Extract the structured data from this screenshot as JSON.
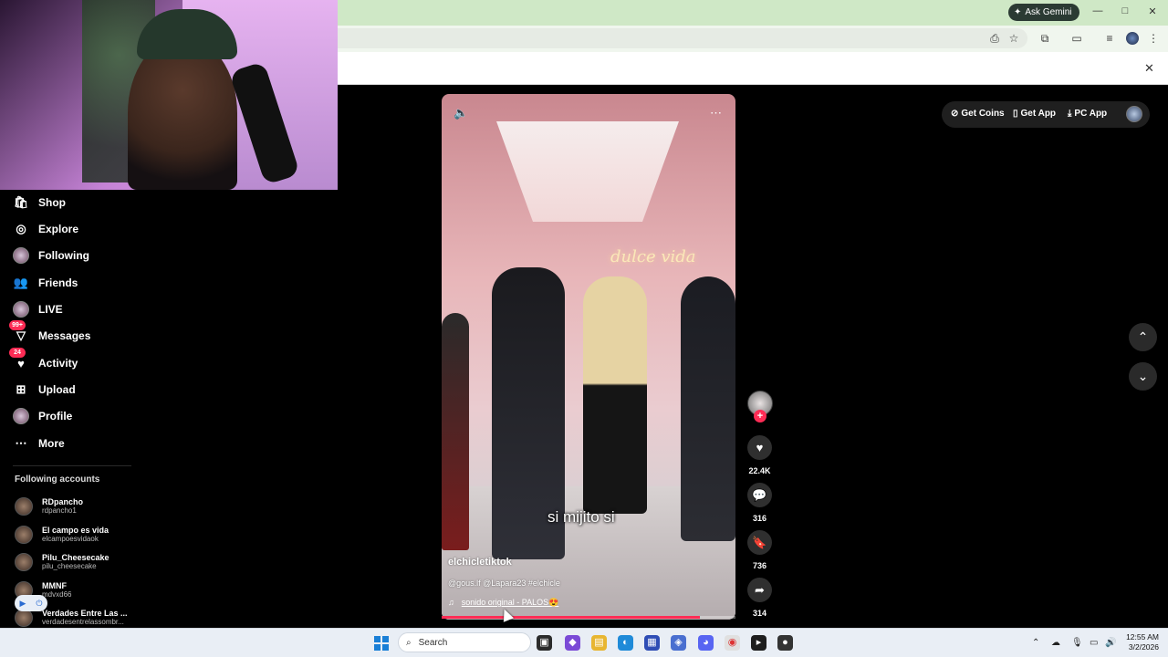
{
  "browser": {
    "ask_gemini": "Ask Gemini",
    "window_controls": [
      "—",
      "□",
      "✕"
    ],
    "infobar_close": "✕"
  },
  "sidebar": {
    "items": [
      {
        "label": "Shop",
        "icon": "shop-icon",
        "glyph": "🛍"
      },
      {
        "label": "Explore",
        "icon": "compass-icon",
        "glyph": "◎"
      },
      {
        "label": "Following",
        "icon": "avatar"
      },
      {
        "label": "Friends",
        "icon": "friends-icon",
        "glyph": "👥"
      },
      {
        "label": "LIVE",
        "icon": "avatar"
      },
      {
        "label": "Messages",
        "icon": "messages-icon",
        "glyph": "▽",
        "badge": "99+"
      },
      {
        "label": "Activity",
        "icon": "activity-icon",
        "glyph": "♥",
        "badge": "24"
      },
      {
        "label": "Upload",
        "icon": "upload-icon",
        "glyph": "⊞"
      },
      {
        "label": "Profile",
        "icon": "avatar"
      },
      {
        "label": "More",
        "icon": "more-icon",
        "glyph": "⋯"
      }
    ],
    "following_title": "Following accounts",
    "accounts": [
      {
        "name": "RDpancho",
        "handle": "rdpancho1"
      },
      {
        "name": "El campo es vida",
        "handle": "elcampoesvidaok"
      },
      {
        "name": "Pilu_Cheesecake",
        "handle": "pilu_cheesecake"
      },
      {
        "name": "MMNF",
        "handle": "mdvxd66"
      },
      {
        "name": "Verdades Entre Las ...",
        "handle": "verdadesentrelassombr..."
      }
    ]
  },
  "video": {
    "neon_sign": "dulce vida",
    "caption": "si mijito si",
    "author": "elchicletiktok",
    "description": "@gous.lf @Lapara23 #elchicle",
    "sound": "sonido original - PALOS😍",
    "progress": 0.88
  },
  "actions": {
    "likes": "22.4K",
    "comments": "316",
    "saves": "736",
    "shares": "314"
  },
  "top_pills": {
    "coins": "Get Coins",
    "app": "Get App",
    "pc": "PC App"
  },
  "taskbar": {
    "search": "Search",
    "time": "12:55 AM",
    "date": "3/2/2026"
  },
  "colors": {
    "accent": "#fe2c55",
    "chrome_green": "#cfe8c6"
  }
}
